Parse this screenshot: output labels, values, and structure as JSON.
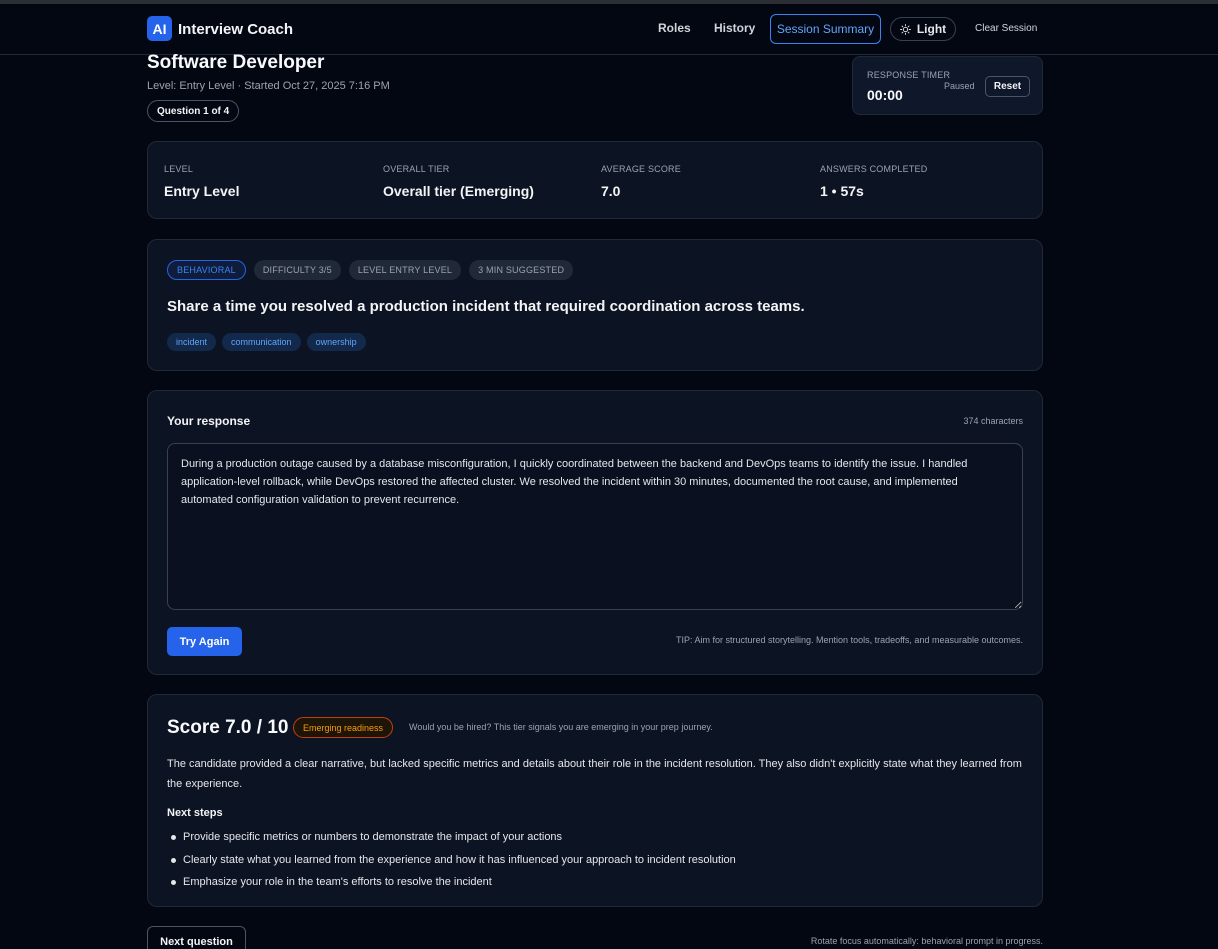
{
  "app": {
    "logo_text": "AI",
    "brand": "Interview Coach"
  },
  "nav": {
    "roles": "Roles",
    "history": "History",
    "session_summary": "Session Summary",
    "theme_toggle": "Light",
    "clear_session": "Clear Session",
    "active_color": "#3b82f6"
  },
  "session": {
    "title": "Software Developer",
    "meta": "Level: Entry Level · Started Oct 27, 2025 7:16 PM",
    "question_progress": "Question 1 of 4"
  },
  "timer": {
    "label": "RESPONSE TIMER",
    "value": "00:00",
    "status": "Paused",
    "reset_label": "Reset"
  },
  "stats": [
    {
      "label": "LEVEL",
      "value": "Entry Level"
    },
    {
      "label": "OVERALL TIER",
      "value": "Overall tier (Emerging)"
    },
    {
      "label": "AVERAGE SCORE",
      "value": "7.0"
    },
    {
      "label": "ANSWERS COMPLETED",
      "value": "1 • 57s"
    }
  ],
  "question": {
    "tags": [
      "BEHAVIORAL",
      "DIFFICULTY 3/5",
      "LEVEL ENTRY LEVEL",
      "3 MIN SUGGESTED"
    ],
    "text": "Share a time you resolved a production incident that required coordination across teams.",
    "topics": [
      "incident",
      "communication",
      "ownership"
    ]
  },
  "response": {
    "title": "Your response",
    "char_count": "374 characters",
    "text": "During a production outage caused by a database misconfiguration, I quickly coordinated between the backend and DevOps teams to identify the issue. I handled application-level rollback, while DevOps restored the affected cluster. We resolved the incident within 30 minutes, documented the root cause, and implemented automated configuration validation to prevent recurrence.",
    "try_again_label": "Try Again",
    "tip": "TIP: Aim for structured storytelling. Mention tools, tradeoffs, and measurable outcomes."
  },
  "score": {
    "title": "Score 7.0 / 10",
    "readiness_badge": "Emerging readiness",
    "hire_note": "Would you be hired? This tier signals you are emerging in your prep journey.",
    "feedback": "The candidate provided a clear narrative, but lacked specific metrics and details about their role in the incident resolution. They also didn't explicitly state what they learned from the experience.",
    "next_steps_title": "Next steps",
    "next_steps": [
      "Provide specific metrics or numbers to demonstrate the impact of your actions",
      "Clearly state what you learned from the experience and how it has influenced your approach to incident resolution",
      "Emphasize your role in the team's efforts to resolve the incident"
    ],
    "badge_color": "#f59e0b"
  },
  "footer": {
    "next_question_label": "Next question",
    "rotate_note": "Rotate focus automatically: behavioral prompt in progress."
  }
}
